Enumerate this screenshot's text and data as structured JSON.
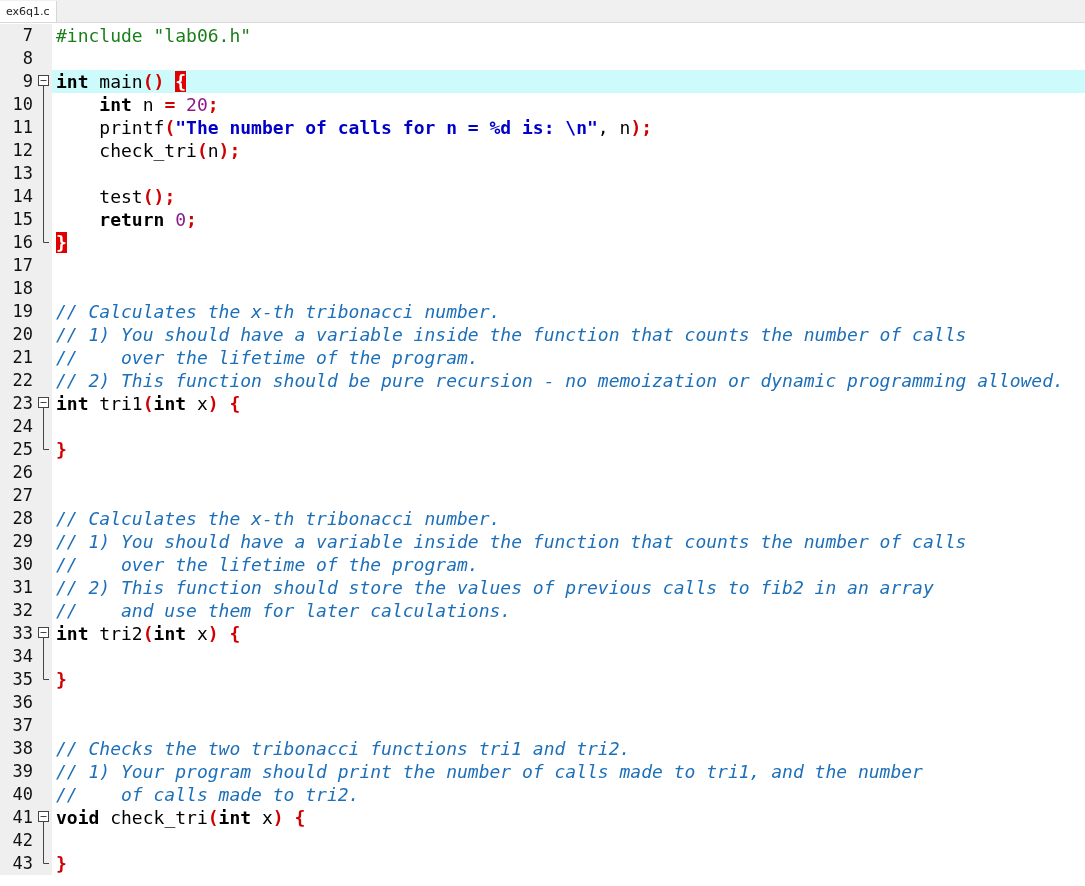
{
  "tab": {
    "label": "ex6q1.c",
    "selected": true
  },
  "lines": [
    {
      "number": "7",
      "kind": "plain",
      "current": false,
      "tokens": [
        {
          "kind": "pre",
          "text": "#include \"lab06.h\""
        }
      ]
    },
    {
      "number": "8",
      "kind": "plain",
      "current": false
    },
    {
      "number": "9",
      "kind": "fold_start",
      "current": true,
      "tokens": [
        {
          "kind": "kw",
          "text": "int"
        },
        {
          "kind": "id",
          "text": " main"
        },
        {
          "kind": "op",
          "text": "() "
        },
        {
          "kind": "match",
          "text": "{"
        }
      ]
    },
    {
      "number": "10",
      "kind": "fold_body",
      "current": false,
      "tokens": [
        {
          "kind": "kw",
          "text": "    int"
        },
        {
          "kind": "id",
          "text": " n "
        },
        {
          "kind": "op",
          "text": "="
        },
        {
          "kind": "num",
          "text": " 20"
        },
        {
          "kind": "op",
          "text": ";"
        }
      ]
    },
    {
      "number": "11",
      "kind": "fold_body",
      "current": false,
      "tokens": [
        {
          "kind": "id",
          "text": "    printf"
        },
        {
          "kind": "op",
          "text": "("
        },
        {
          "kind": "str",
          "text": "\"The number of calls for n = %d is: \\n\""
        },
        {
          "kind": "id",
          "text": ", n"
        },
        {
          "kind": "op",
          "text": ");"
        }
      ]
    },
    {
      "number": "12",
      "kind": "fold_body",
      "current": false,
      "tokens": [
        {
          "kind": "id",
          "text": "    check_tri"
        },
        {
          "kind": "op",
          "text": "("
        },
        {
          "kind": "id",
          "text": "n"
        },
        {
          "kind": "op",
          "text": ");"
        }
      ]
    },
    {
      "number": "13",
      "kind": "fold_body",
      "current": false
    },
    {
      "number": "14",
      "kind": "fold_body",
      "current": false,
      "tokens": [
        {
          "kind": "id",
          "text": "    test"
        },
        {
          "kind": "op",
          "text": "();"
        }
      ]
    },
    {
      "number": "15",
      "kind": "fold_body",
      "current": false,
      "tokens": [
        {
          "kind": "kw",
          "text": "    return"
        },
        {
          "kind": "num",
          "text": " 0"
        },
        {
          "kind": "op",
          "text": ";"
        }
      ]
    },
    {
      "number": "16",
      "kind": "fold_end",
      "current": false,
      "tokens": [
        {
          "kind": "match",
          "text": "}"
        }
      ]
    },
    {
      "number": "17",
      "kind": "plain",
      "current": false
    },
    {
      "number": "18",
      "kind": "plain",
      "current": false
    },
    {
      "number": "19",
      "kind": "plain",
      "current": false,
      "tokens": [
        {
          "kind": "com",
          "text": "// Calculates the x-th tribonacci number."
        }
      ]
    },
    {
      "number": "20",
      "kind": "plain",
      "current": false,
      "tokens": [
        {
          "kind": "com",
          "text": "// 1) You should have a variable inside the function that counts the number of calls"
        }
      ]
    },
    {
      "number": "21",
      "kind": "plain",
      "current": false,
      "tokens": [
        {
          "kind": "com",
          "text": "//    over the lifetime of the program."
        }
      ]
    },
    {
      "number": "22",
      "kind": "plain",
      "current": false,
      "tokens": [
        {
          "kind": "com",
          "text": "// 2) This function should be pure recursion - no memoization or dynamic programming allowed."
        }
      ]
    },
    {
      "number": "23",
      "kind": "fold_start",
      "current": false,
      "tokens": [
        {
          "kind": "kw",
          "text": "int"
        },
        {
          "kind": "id",
          "text": " tri1"
        },
        {
          "kind": "op",
          "text": "("
        },
        {
          "kind": "kw",
          "text": "int"
        },
        {
          "kind": "id",
          "text": " x"
        },
        {
          "kind": "op",
          "text": ") {"
        }
      ]
    },
    {
      "number": "24",
      "kind": "fold_body",
      "current": false
    },
    {
      "number": "25",
      "kind": "fold_end",
      "current": false,
      "tokens": [
        {
          "kind": "op",
          "text": "}"
        }
      ]
    },
    {
      "number": "26",
      "kind": "plain",
      "current": false
    },
    {
      "number": "27",
      "kind": "plain",
      "current": false
    },
    {
      "number": "28",
      "kind": "plain",
      "current": false,
      "tokens": [
        {
          "kind": "com",
          "text": "// Calculates the x-th tribonacci number."
        }
      ]
    },
    {
      "number": "29",
      "kind": "plain",
      "current": false,
      "tokens": [
        {
          "kind": "com",
          "text": "// 1) You should have a variable inside the function that counts the number of calls"
        }
      ]
    },
    {
      "number": "30",
      "kind": "plain",
      "current": false,
      "tokens": [
        {
          "kind": "com",
          "text": "//    over the lifetime of the program."
        }
      ]
    },
    {
      "number": "31",
      "kind": "plain",
      "current": false,
      "tokens": [
        {
          "kind": "com",
          "text": "// 2) This function should store the values of previous calls to fib2 in an array"
        }
      ]
    },
    {
      "number": "32",
      "kind": "plain",
      "current": false,
      "tokens": [
        {
          "kind": "com",
          "text": "//    and use them for later calculations."
        }
      ]
    },
    {
      "number": "33",
      "kind": "fold_start",
      "current": false,
      "tokens": [
        {
          "kind": "kw",
          "text": "int"
        },
        {
          "kind": "id",
          "text": " tri2"
        },
        {
          "kind": "op",
          "text": "("
        },
        {
          "kind": "kw",
          "text": "int"
        },
        {
          "kind": "id",
          "text": " x"
        },
        {
          "kind": "op",
          "text": ") {"
        }
      ]
    },
    {
      "number": "34",
      "kind": "fold_body",
      "current": false
    },
    {
      "number": "35",
      "kind": "fold_end",
      "current": false,
      "tokens": [
        {
          "kind": "op",
          "text": "}"
        }
      ]
    },
    {
      "number": "36",
      "kind": "plain",
      "current": false
    },
    {
      "number": "37",
      "kind": "plain",
      "current": false
    },
    {
      "number": "38",
      "kind": "plain",
      "current": false,
      "tokens": [
        {
          "kind": "com",
          "text": "// Checks the two tribonacci functions tri1 and tri2."
        }
      ]
    },
    {
      "number": "39",
      "kind": "plain",
      "current": false,
      "tokens": [
        {
          "kind": "com",
          "text": "// 1) Your program should print the number of calls made to tri1, and the number"
        }
      ]
    },
    {
      "number": "40",
      "kind": "plain",
      "current": false,
      "tokens": [
        {
          "kind": "com",
          "text": "//    of calls made to tri2."
        }
      ]
    },
    {
      "number": "41",
      "kind": "fold_start",
      "current": false,
      "tokens": [
        {
          "kind": "kw",
          "text": "void"
        },
        {
          "kind": "id",
          "text": " check_tri"
        },
        {
          "kind": "op",
          "text": "("
        },
        {
          "kind": "kw",
          "text": "int"
        },
        {
          "kind": "id",
          "text": " x"
        },
        {
          "kind": "op",
          "text": ") {"
        }
      ]
    },
    {
      "number": "42",
      "kind": "fold_body",
      "current": false
    },
    {
      "number": "43",
      "kind": "fold_end",
      "current": false,
      "tokens": [
        {
          "kind": "op",
          "text": "}"
        }
      ]
    }
  ]
}
